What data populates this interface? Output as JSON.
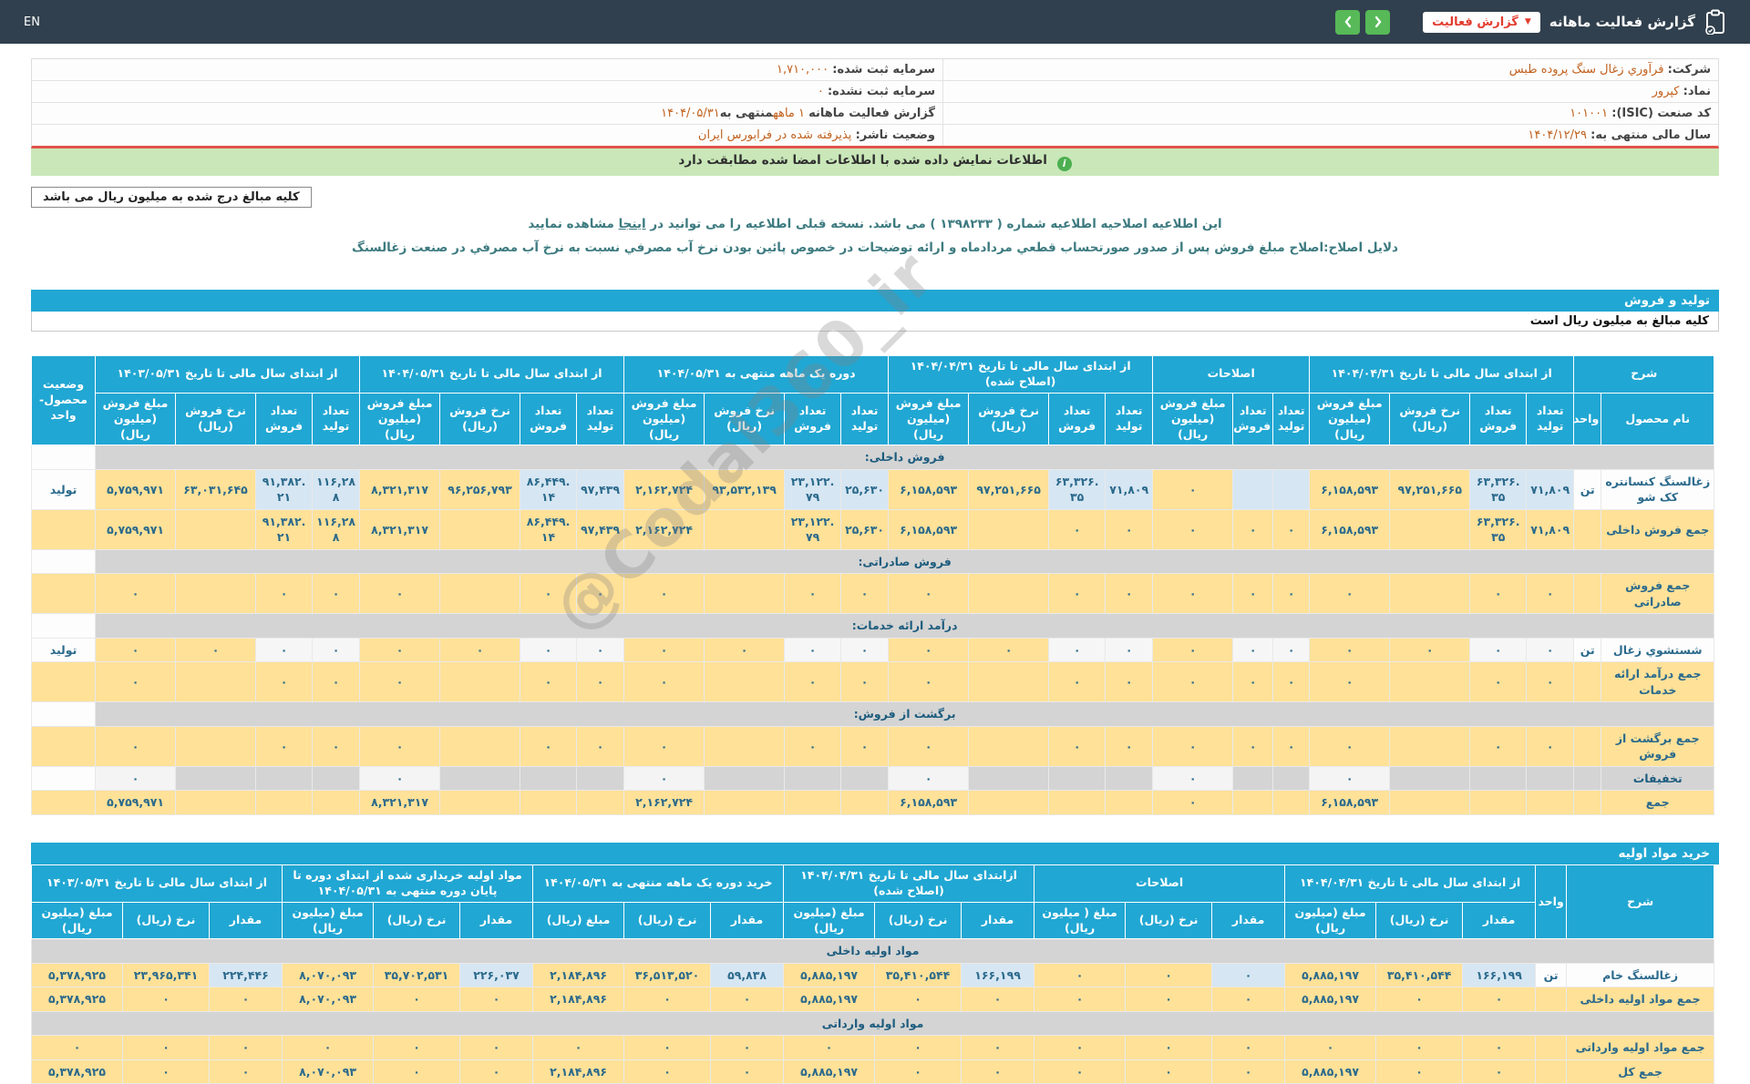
{
  "topbar": {
    "en": "EN",
    "title": "گزارش فعالیت ماهانه",
    "report_chip": "گزارش فعالیت"
  },
  "info": {
    "right": {
      "company": {
        "label": "شرکت:",
        "value": "فرآوري زغال سنگ پروده طبس"
      },
      "symbol": {
        "label": "نماد:",
        "value": "کپرور"
      },
      "isic": {
        "label": "کد صنعت (ISIC):",
        "value": "۱۰۱۰۰۱"
      },
      "fiscal": {
        "label": "سال مالی منتهی به:",
        "value": "۱۴۰۴/۱۲/۲۹"
      }
    },
    "left": {
      "cap_reg": {
        "label": "سرمایه ثبت شده:",
        "value": "۱,۷۱۰,۰۰۰"
      },
      "cap_unreg": {
        "label": "سرمایه ثبت نشده:",
        "value": "۰"
      },
      "report": {
        "label": "گزارش فعالیت ماهانه",
        "duration": "۱ ماهه",
        "mid": "منتهی به",
        "date": "۱۴۰۴/۰۵/۳۱"
      },
      "issuer": {
        "label": "وضعیت ناشر:",
        "value": "پذیرفته شده در فرابورس ایران"
      }
    }
  },
  "banner": {
    "text": "اطلاعات نمایش داده شده با اطلاعات امضا شده مطابقت دارد"
  },
  "note_box": "کلیه مبالغ درج شده به میلیون ریال می باشد",
  "amendment": {
    "line1_pre": "این اطلاعیه اصلاحیه اطلاعیه شماره ( ۱۳۹۸۲۳۳ ) می باشد. نسخه قبلی اطلاعیه را می توانید در",
    "line1_link": "اینجا",
    "line1_post": "مشاهده نمایید",
    "line2": "دلایل اصلاح:اصلاح مبلغ فروش پس از صدور صورتحساب قطعي مردادماه و ارائه توضیحات در خصوص پائین بودن نرخ آب مصرفي نسبت به نرخ آب مصرفي در صنعت زغالسنگ"
  },
  "watermark": "@Codal360_ir",
  "tables": [
    {
      "bar": "تولید و فروش",
      "subtitle": "کلیه مبالغ به میلیون ریال است",
      "lead": {
        "label": "شرح",
        "subs": [
          "نام محصول",
          "واحد"
        ]
      },
      "status_label": "وضعیت محصول-واحد",
      "groups": [
        {
          "label": "از ابتدای سال مالی تا تاریخ ۱۴۰۴/۰۴/۳۱",
          "subs": [
            "تعداد تولید",
            "تعداد فروش",
            "نرخ فروش (ریال)",
            "مبلغ فروش (میلیون ریال)"
          ]
        },
        {
          "label": "اصلاحات",
          "subs": [
            "تعداد تولید",
            "تعداد فروش",
            "مبلغ فروش (میلیون ریال)"
          ]
        },
        {
          "label": "از ابتدای سال مالی تا تاریخ ۱۴۰۴/۰۴/۳۱ (اصلاح شده)",
          "subs": [
            "تعداد تولید",
            "تعداد فروش",
            "نرخ فروش (ریال)",
            "مبلغ فروش (میلیون ریال)"
          ]
        },
        {
          "label": "دوره یک ماهه منتهی به ۱۴۰۴/۰۵/۳۱",
          "subs": [
            "تعداد تولید",
            "تعداد فروش",
            "نرخ فروش (ریال)",
            "مبلغ فروش (میلیون ریال)"
          ]
        },
        {
          "label": "از ابتدای سال مالی تا تاریخ ۱۴۰۴/۰۵/۳۱",
          "subs": [
            "تعداد تولید",
            "تعداد فروش",
            "نرخ فروش (ریال)",
            "مبلغ فروش (میلیون ریال)"
          ]
        },
        {
          "label": "از ابتدای سال مالی تا تاریخ ۱۴۰۳/۰۵/۳۱",
          "subs": [
            "تعداد تولید",
            "تعداد فروش",
            "نرخ فروش (ریال)",
            "مبلغ فروش (میلیون ریال)"
          ]
        }
      ],
      "types": [
        "c",
        "c",
        "a",
        "a",
        "c",
        "c",
        "a",
        "c",
        "c",
        "a",
        "a",
        "c",
        "c",
        "a",
        "a",
        "c",
        "c",
        "a",
        "a",
        "c",
        "c",
        "a",
        "a"
      ],
      "widths": [
        124,
        30,
        52,
        62,
        88,
        88,
        40,
        44,
        88,
        52,
        62,
        88,
        88,
        52,
        62,
        88,
        88,
        52,
        62,
        88,
        88,
        52,
        62,
        88,
        88,
        70
      ],
      "rows": [
        {
          "kind": "section",
          "name": "فروش داخلی:"
        },
        {
          "kind": "product",
          "tint": "blue",
          "name": "زغالسنگ کنسانتره کک شو",
          "unit": "تن",
          "status": "تولید",
          "cells": [
            "۷۱,۸۰۹",
            "۶۳,۳۲۶.۳۵",
            "۹۷,۲۵۱,۶۶۵",
            "۶,۱۵۸,۵۹۳",
            "",
            "",
            "۰",
            "۷۱,۸۰۹",
            "۶۳,۳۲۶.۳۵",
            "۹۷,۲۵۱,۶۶۵",
            "۶,۱۵۸,۵۹۳",
            "۲۵,۶۳۰",
            "۲۳,۱۲۲.۷۹",
            "۹۳,۵۳۲,۱۳۹",
            "۲,۱۶۲,۷۲۴",
            "۹۷,۴۳۹",
            "۸۶,۴۴۹.۱۴",
            "۹۶,۲۵۶,۷۹۳",
            "۸,۳۲۱,۳۱۷",
            "۱۱۶,۲۸۸",
            "۹۱,۳۸۲.۲۱",
            "۶۳,۰۳۱,۶۴۵",
            "۵,۷۵۹,۹۷۱"
          ]
        },
        {
          "kind": "total",
          "name": "جمع فروش داخلی",
          "cells": [
            "۷۱,۸۰۹",
            "۶۳,۳۲۶.۳۵",
            "",
            "۶,۱۵۸,۵۹۳",
            "۰",
            "۰",
            "۰",
            "۰",
            "۰",
            "",
            "۶,۱۵۸,۵۹۳",
            "۲۵,۶۳۰",
            "۲۳,۱۲۲.۷۹",
            "",
            "۲,۱۶۲,۷۲۴",
            "۹۷,۴۳۹",
            "۸۶,۴۴۹.۱۴",
            "",
            "۸,۳۲۱,۳۱۷",
            "۱۱۶,۲۸۸",
            "۹۱,۳۸۲.۲۱",
            "",
            "۵,۷۵۹,۹۷۱"
          ]
        },
        {
          "kind": "section",
          "name": "فروش صادراتی:"
        },
        {
          "kind": "total",
          "name": "جمع فروش صادراتی",
          "cells": [
            "۰",
            "۰",
            "",
            "۰",
            "۰",
            "۰",
            "۰",
            "۰",
            "۰",
            "",
            "۰",
            "۰",
            "۰",
            "",
            "۰",
            "۰",
            "۰",
            "",
            "۰",
            "۰",
            "۰",
            "",
            "۰"
          ]
        },
        {
          "kind": "section",
          "name": "درآمد ارائه خدمات:"
        },
        {
          "kind": "product",
          "tint": "white",
          "name": "شستشوي زغال",
          "unit": "تن",
          "status": "تولید",
          "cells": [
            "۰",
            "۰",
            "۰",
            "۰",
            "۰",
            "۰",
            "۰",
            "۰",
            "۰",
            "۰",
            "۰",
            "۰",
            "۰",
            "۰",
            "۰",
            "۰",
            "۰",
            "۰",
            "۰",
            "۰",
            "۰",
            "۰",
            "۰"
          ]
        },
        {
          "kind": "total",
          "name": "جمع درآمد ارائه خدمات",
          "cells": [
            "۰",
            "۰",
            "",
            "۰",
            "۰",
            "۰",
            "۰",
            "۰",
            "۰",
            "",
            "۰",
            "۰",
            "۰",
            "",
            "۰",
            "۰",
            "۰",
            "",
            "۰",
            "۰",
            "۰",
            "",
            "۰"
          ]
        },
        {
          "kind": "section",
          "name": "برگشت از فروش:"
        },
        {
          "kind": "total",
          "name": "جمع برگشت از فروش",
          "cells": [
            "۰",
            "۰",
            "",
            "۰",
            "۰",
            "۰",
            "۰",
            "۰",
            "۰",
            "",
            "۰",
            "۰",
            "۰",
            "",
            "۰",
            "۰",
            "۰",
            "",
            "۰",
            "۰",
            "۰",
            "",
            "۰"
          ]
        },
        {
          "kind": "discount",
          "name": "تخفیفات",
          "cells": [
            "",
            "",
            "",
            "۰",
            "",
            "",
            "۰",
            "",
            "",
            "",
            "۰",
            "",
            "",
            "",
            "۰",
            "",
            "",
            "",
            "۰",
            "",
            "",
            "",
            "۰"
          ]
        },
        {
          "kind": "grand",
          "name": "جمع",
          "cells": [
            "",
            "",
            "",
            "۶,۱۵۸,۵۹۳",
            "",
            "",
            "۰",
            "",
            "",
            "",
            "۶,۱۵۸,۵۹۳",
            "",
            "",
            "",
            "۲,۱۶۲,۷۲۴",
            "",
            "",
            "",
            "۸,۳۲۱,۳۱۷",
            "",
            "",
            "",
            "۵,۷۵۹,۹۷۱"
          ]
        }
      ]
    },
    {
      "bar": "خرید مواد اولیه",
      "subtitle": "",
      "lead": {
        "label": "شرح",
        "unit_label": "واحد",
        "subs": []
      },
      "status_label": null,
      "groups": [
        {
          "label": "از ابتدای سال مالی تا تاریخ ۱۴۰۴/۰۴/۳۱",
          "subs": [
            "مقدار",
            "نرخ (ریال)",
            "مبلغ (میلیون ریال)"
          ]
        },
        {
          "label": "اصلاحات",
          "subs": [
            "مقدار",
            "نرخ (ریال)",
            "مبلغ ( میلیون ریال)"
          ]
        },
        {
          "label": "ازابتدای سال مالی تا تاریخ ۱۴۰۴/۰۴/۳۱ (اصلاح شده)",
          "subs": [
            "مقدار",
            "نرخ (ریال)",
            "مبلغ (میلیون ریال)"
          ]
        },
        {
          "label": "خرید دوره یک ماهه منتهی به ۱۴۰۴/۰۵/۳۱",
          "subs": [
            "مقدار",
            "نرخ (ریال)",
            "مبلغ (ریال)"
          ]
        },
        {
          "label": "مواد اولیه خریداری شده از ابتدای دوره تا پایان دوره منتهی به ۱۴۰۴/۰۵/۳۱",
          "subs": [
            "مقدار",
            "نرخ (ریال)",
            "مبلغ (میلیون ریال)"
          ]
        },
        {
          "label": "از ابتدای سال مالی تا تاریخ ۱۴۰۳/۰۵/۳۱",
          "subs": [
            "مقدار",
            "نرخ (ریال)",
            "مبلغ (میلیون ریال)"
          ]
        }
      ],
      "types": [
        "c",
        "a",
        "a",
        "c",
        "a",
        "a",
        "c",
        "a",
        "a",
        "c",
        "a",
        "a",
        "c",
        "a",
        "a",
        "c",
        "a",
        "a"
      ],
      "widths": [
        162,
        34,
        80,
        95,
        100,
        80,
        95,
        100,
        80,
        95,
        100,
        80,
        95,
        100,
        80,
        95,
        100,
        80,
        95,
        100
      ],
      "rows": [
        {
          "kind": "section",
          "name": "مواد اولیه داخلی"
        },
        {
          "kind": "product",
          "tint": "blue",
          "name": "زغالسنگ خام",
          "unit": "تن",
          "cells": [
            "۱۶۶,۱۹۹",
            "۳۵,۴۱۰,۵۴۴",
            "۵,۸۸۵,۱۹۷",
            "۰",
            "۰",
            "۰",
            "۱۶۶,۱۹۹",
            "۳۵,۴۱۰,۵۴۴",
            "۵,۸۸۵,۱۹۷",
            "۵۹,۸۳۸",
            "۳۶,۵۱۳,۵۲۰",
            "۲,۱۸۴,۸۹۶",
            "۲۲۶,۰۳۷",
            "۳۵,۷۰۲,۵۳۱",
            "۸,۰۷۰,۰۹۳",
            "۲۲۴,۴۴۶",
            "۲۳,۹۶۵,۳۴۱",
            "۵,۳۷۸,۹۲۵"
          ]
        },
        {
          "kind": "total",
          "name": "جمع مواد اولیه داخلی",
          "cells": [
            "۰",
            "۰",
            "۵,۸۸۵,۱۹۷",
            "۰",
            "۰",
            "۰",
            "۰",
            "۰",
            "۵,۸۸۵,۱۹۷",
            "۰",
            "۰",
            "۲,۱۸۴,۸۹۶",
            "۰",
            "۰",
            "۸,۰۷۰,۰۹۳",
            "۰",
            "۰",
            "۵,۳۷۸,۹۲۵"
          ]
        },
        {
          "kind": "section",
          "name": "مواد اولیه وارداتی"
        },
        {
          "kind": "total",
          "name": "جمع مواد اولیه وارداتی",
          "cells": [
            "۰",
            "۰",
            "۰",
            "۰",
            "۰",
            "۰",
            "۰",
            "۰",
            "۰",
            "۰",
            "۰",
            "۰",
            "۰",
            "۰",
            "۰",
            "۰",
            "۰",
            "۰"
          ]
        },
        {
          "kind": "grand",
          "name": "جمع کل",
          "cells": [
            "۰",
            "۰",
            "۵,۸۸۵,۱۹۷",
            "۰",
            "۰",
            "۰",
            "۰",
            "۰",
            "۵,۸۸۵,۱۹۷",
            "۰",
            "۰",
            "۲,۱۸۴,۸۹۶",
            "۰",
            "۰",
            "۸,۰۷۰,۰۹۳",
            "۰",
            "۰",
            "۵,۳۷۸,۹۲۵"
          ]
        }
      ]
    }
  ]
}
